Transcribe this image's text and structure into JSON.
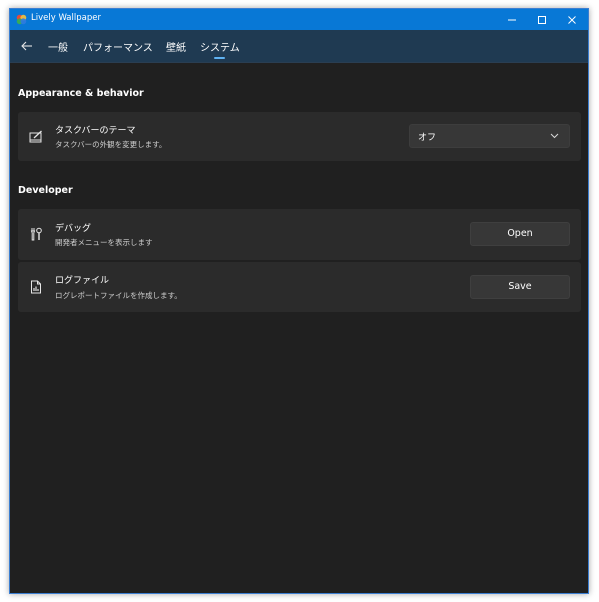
{
  "window": {
    "title": "Lively Wallpaper",
    "controls": {
      "minimize": "minimize-icon",
      "maximize": "maximize-icon",
      "close": "close-icon"
    }
  },
  "nav": {
    "back_icon": "back-arrow-icon",
    "tabs": [
      {
        "label": "一般"
      },
      {
        "label": "パフォーマンス"
      },
      {
        "label": "壁紙"
      },
      {
        "label": "システム",
        "selected": true
      }
    ]
  },
  "sections": {
    "appearance": {
      "title": "Appearance & behavior",
      "taskbar_theme": {
        "icon": "taskbar-pen-icon",
        "title": "タスクバーのテーマ",
        "description": "タスクバーの外観を変更します。",
        "selected_option": "オフ"
      }
    },
    "developer": {
      "title": "Developer",
      "debug": {
        "icon": "tools-icon",
        "title": "デバッグ",
        "description": "開発者メニューを表示します",
        "button_label": "Open"
      },
      "logfile": {
        "icon": "log-file-icon",
        "title": "ログファイル",
        "description": "ログレポートファイルを作成します。",
        "button_label": "Save"
      }
    }
  },
  "colors": {
    "titlebar": "#0878d6",
    "navbar": "#1f3a52",
    "background": "#202020",
    "card": "#2b2b2b",
    "accent": "#5fb2f2"
  }
}
